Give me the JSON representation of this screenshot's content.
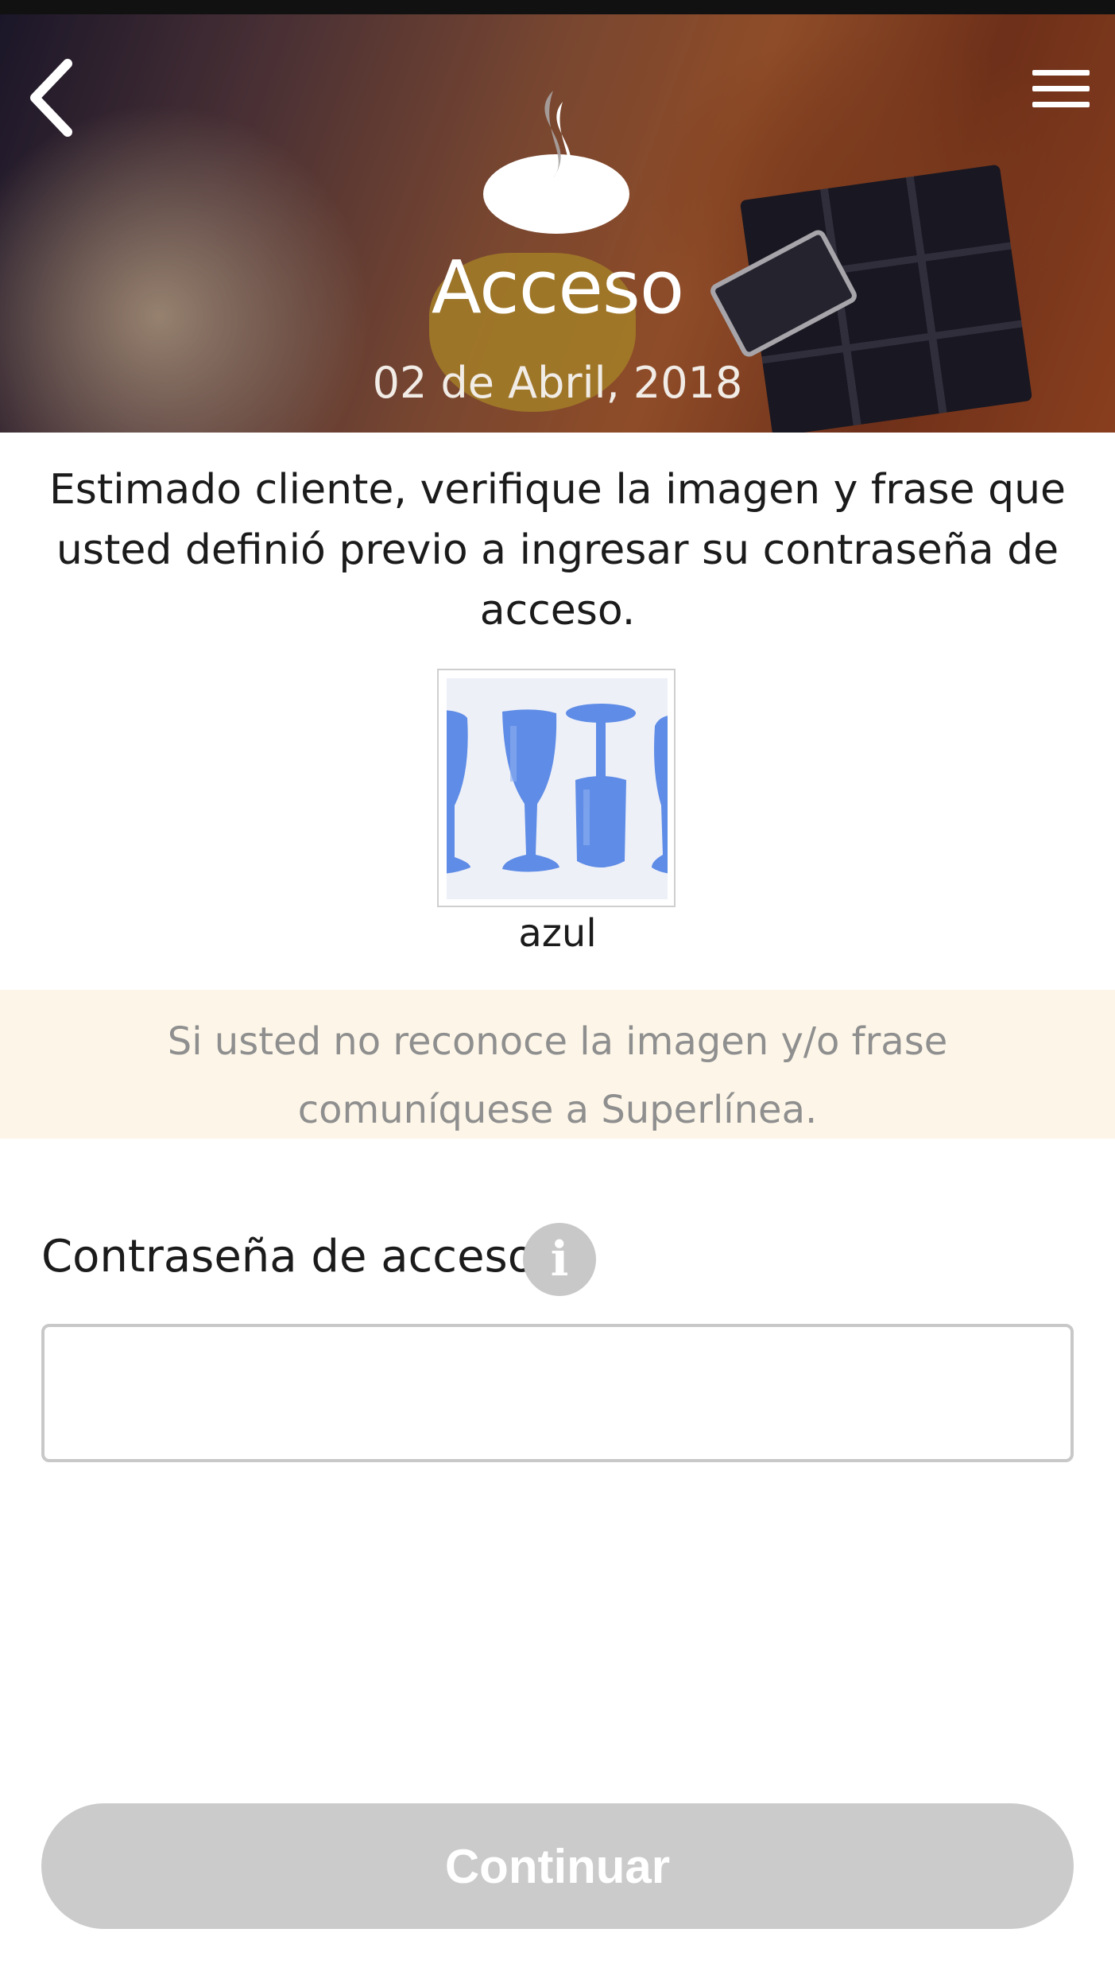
{
  "header": {
    "title": "Acceso",
    "date": "02 de Abril, 2018",
    "back_icon": "chevron-left-icon",
    "menu_icon": "hamburger-menu-icon",
    "logo_icon": "santander-flame-logo"
  },
  "intro": {
    "text": "Estimado cliente, verifique la imagen y frase que usted definió previo a ingresar su contraseña de acceso."
  },
  "security": {
    "image_description": "blue-glasses",
    "phrase": "azul"
  },
  "notice": {
    "text": "Si usted no reconoce la imagen y/o frase comuníquese a Superlínea."
  },
  "password": {
    "label": "Contraseña de acceso",
    "info_icon": "info-icon",
    "value": "",
    "placeholder": ""
  },
  "actions": {
    "continue_label": "Continuar"
  },
  "colors": {
    "notice_bg": "#fdf6e8",
    "button_disabled": "#cbcbcb",
    "info_icon_bg": "#c8c8c8"
  }
}
